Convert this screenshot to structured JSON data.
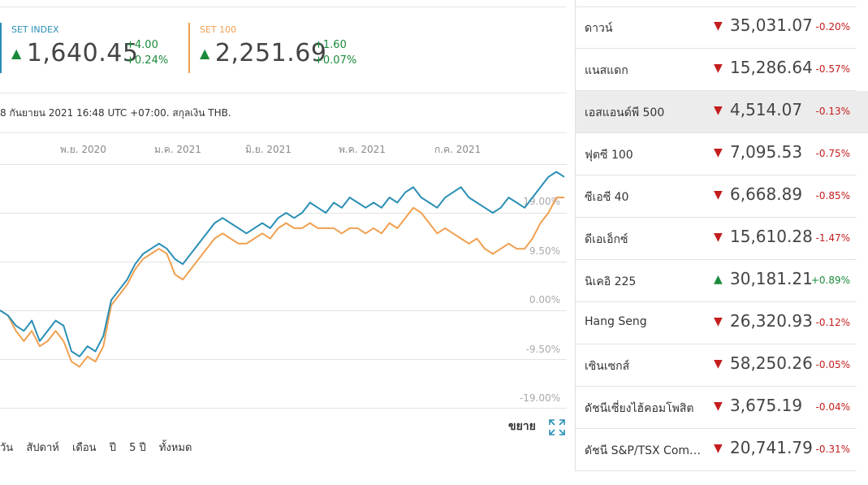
{
  "indices": [
    {
      "name": "SET INDEX",
      "value": "1,640.45",
      "change": "+4.00",
      "change_pct": "+0.24%",
      "color": "#2a8fb5",
      "direction": "up"
    },
    {
      "name": "SET 100",
      "value": "2,251.69",
      "change": "+1.60",
      "change_pct": "+0.07%",
      "color": "#f0a050",
      "direction": "up"
    }
  ],
  "timestamp": "8 กันยายน 2021 16:48 UTC +07:00. สกุลเงิน THB.",
  "chart": {
    "x_labels": [
      "พ.ย. 2020",
      "ม.ค. 2021",
      "มิ.ย. 2021",
      "พ.ค. 2021",
      "ก.ค. 2021"
    ],
    "y_labels": [
      "19.00%",
      "9.50%",
      "0.00%",
      "-9.50%",
      "-19.00%"
    ]
  },
  "chart_data": {
    "type": "line",
    "x_tick_labels": [
      "พ.ย. 2020",
      "ม.ค. 2021",
      "มิ.ย. 2021",
      "พ.ค. 2021",
      "ก.ค. 2021"
    ],
    "y_tick_labels": [
      "19.00%",
      "9.50%",
      "0.00%",
      "-9.50%",
      "-19.00%"
    ],
    "ylim": [
      -19,
      19
    ],
    "series": [
      {
        "name": "SET INDEX",
        "color": "#2a8fb5",
        "values": [
          0,
          -1,
          -3,
          -4,
          -2,
          -6,
          -4,
          -2,
          -3,
          -8,
          -9,
          -7,
          -8,
          -5,
          2,
          4,
          6,
          9,
          11,
          12,
          13,
          12,
          10,
          9,
          11,
          13,
          15,
          17,
          18,
          17,
          16,
          15,
          16,
          17,
          16,
          18,
          19,
          18,
          19,
          21,
          20,
          19,
          21,
          20,
          22,
          21,
          20,
          21,
          20,
          22,
          21,
          23,
          24,
          22,
          21,
          20,
          22,
          23,
          24,
          22,
          21,
          20,
          19,
          20,
          22,
          21,
          20,
          22,
          24,
          26,
          27,
          26
        ]
      },
      {
        "name": "SET 100",
        "color": "#f0a050",
        "values": [
          0,
          -1,
          -4,
          -6,
          -4,
          -7,
          -6,
          -4,
          -6,
          -10,
          -11,
          -9,
          -10,
          -7,
          1,
          3,
          5,
          8,
          10,
          11,
          12,
          11,
          7,
          6,
          8,
          10,
          12,
          14,
          15,
          14,
          13,
          13,
          14,
          15,
          14,
          16,
          17,
          16,
          16,
          17,
          16,
          16,
          16,
          15,
          16,
          16,
          15,
          16,
          15,
          17,
          16,
          18,
          20,
          19,
          17,
          15,
          16,
          15,
          14,
          13,
          14,
          12,
          11,
          12,
          13,
          12,
          12,
          14,
          17,
          19,
          22,
          22
        ]
      }
    ]
  },
  "expand_label": "ขยาย",
  "ranges": [
    "วัน",
    "สัปดาห์",
    "เดือน",
    "ปี",
    "5 ปี",
    "ทั้งหมด"
  ],
  "markets": [
    {
      "name": "ดาวน์",
      "value": "35,031.07",
      "pct": "-0.20%",
      "dir": "down"
    },
    {
      "name": "แนสแดก",
      "value": "15,286.64",
      "pct": "-0.57%",
      "dir": "down"
    },
    {
      "name": "เอสแอนด์พี 500",
      "value": "4,514.07",
      "pct": "-0.13%",
      "dir": "down"
    },
    {
      "name": "ฟุตซี 100",
      "value": "7,095.53",
      "pct": "-0.75%",
      "dir": "down"
    },
    {
      "name": "ซีเอซี 40",
      "value": "6,668.89",
      "pct": "-0.85%",
      "dir": "down"
    },
    {
      "name": "ดีเอเอ็กซ์",
      "value": "15,610.28",
      "pct": "-1.47%",
      "dir": "down"
    },
    {
      "name": "นิเคอิ 225",
      "value": "30,181.21",
      "pct": "+0.89%",
      "dir": "up"
    },
    {
      "name": "Hang Seng",
      "value": "26,320.93",
      "pct": "-0.12%",
      "dir": "down"
    },
    {
      "name": "เซินเซกส์",
      "value": "58,250.26",
      "pct": "-0.05%",
      "dir": "down"
    },
    {
      "name": "ดัชนีเซี่ยงไฮ้คอมโพสิต",
      "value": "3,675.19",
      "pct": "-0.04%",
      "dir": "down"
    },
    {
      "name": "ดัชนี S&P/TSX Com…",
      "value": "20,741.79",
      "pct": "-0.31%",
      "dir": "down"
    }
  ]
}
